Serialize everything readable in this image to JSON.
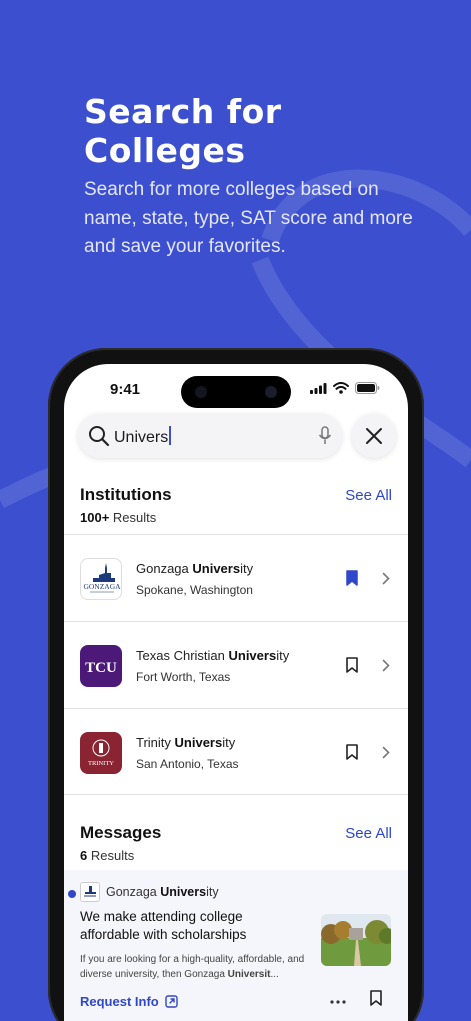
{
  "promo": {
    "title": "Search for Colleges",
    "subtitle": "Search for more colleges based on name, state, type, SAT score and more and save your favorites."
  },
  "status_bar": {
    "time": "9:41"
  },
  "search": {
    "value": "Univers"
  },
  "institutions": {
    "title": "Institutions",
    "see_all": "See All",
    "count": "100+",
    "count_label": "Results",
    "items": [
      {
        "name_prefix": "Gonzaga ",
        "name_match": "Univers",
        "name_suffix": "ity",
        "location": "Spokane, Washington",
        "saved": true,
        "logo_text": "GONZAGA"
      },
      {
        "name_prefix": "Texas Christian ",
        "name_match": "Univers",
        "name_suffix": "ity",
        "location": "Fort Worth, Texas",
        "saved": false,
        "logo_text": "TCU"
      },
      {
        "name_prefix": "Trinity ",
        "name_match": "Univers",
        "name_suffix": "ity",
        "location": "San Antonio, Texas",
        "saved": false,
        "logo_text": "TRINITY"
      }
    ]
  },
  "messages": {
    "title": "Messages",
    "see_all": "See All",
    "count": "6",
    "count_label": "Results",
    "item": {
      "from_prefix": "Gonzaga ",
      "from_match": "Univers",
      "from_suffix": "ity",
      "subject": "We make attending college affordable with scholarships",
      "preview_prefix": "If you are looking for a high-quality, affordable, and diverse university, then Gonzaga ",
      "preview_match": "Universit",
      "preview_suffix": "...",
      "cta": "Request Info",
      "unread": true
    }
  },
  "colors": {
    "background": "#3b4fcf",
    "accent": "#2f47c8",
    "tcu_purple": "#4d1979",
    "trinity_maroon": "#8a2432"
  }
}
